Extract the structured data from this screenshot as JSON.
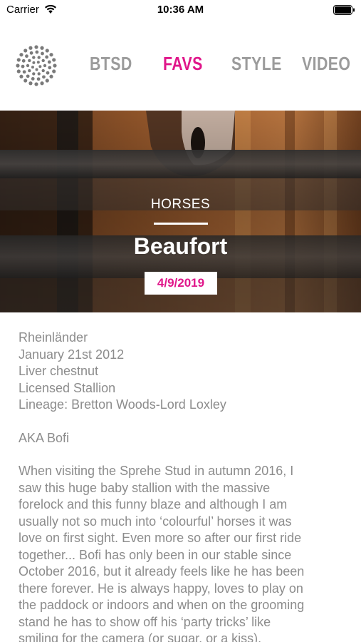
{
  "status_bar": {
    "carrier": "Carrier",
    "time": "10:36 AM"
  },
  "nav": {
    "tabs": [
      {
        "label": "BTSD",
        "active": false
      },
      {
        "label": "FAVS",
        "active": true
      },
      {
        "label": "STYLE",
        "active": false
      },
      {
        "label": "VIDEO",
        "active": false
      }
    ]
  },
  "colors": {
    "accent": "#e0168a",
    "tab_inactive": "#9b9b9b",
    "body_text": "#8c8c8c"
  },
  "hero": {
    "category": "HORSES",
    "title": "Beaufort",
    "date": "4/9/2019"
  },
  "details": {
    "lines": [
      "Rheinländer",
      "January 21st 2012",
      "Liver chestnut",
      "Licensed Stallion",
      "Lineage: Bretton Woods-Lord Loxley"
    ],
    "aka": "AKA Bofi",
    "story_lines": [
      "When visiting the Sprehe Stud in autumn 2016, I",
      "saw this huge baby stallion with the massive",
      "forelock and this funny blaze and although I am",
      "usually not so much into ‘colourful’ horses it was",
      "love on first sight. Even more so after our first ride",
      "together... Bofi has only been in our stable since",
      "October 2016, but it already feels like he has been",
      "there forever. He is always happy, loves to play on",
      "the paddock or indoors and when on the grooming",
      "stand he has to show off his ‘party tricks’ like",
      "smiling for the camera (or sugar, or a kiss)."
    ]
  }
}
